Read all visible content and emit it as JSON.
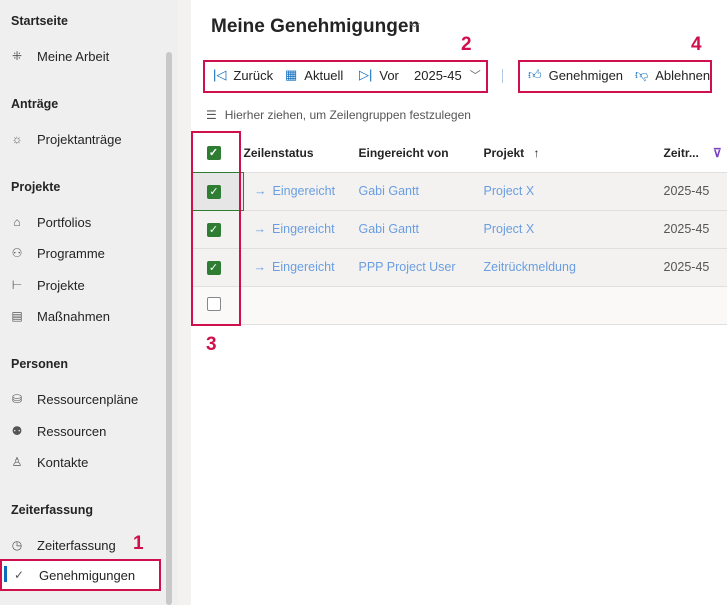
{
  "sidebar": {
    "sections": [
      {
        "title": "Startseite",
        "items": [
          {
            "label": "Meine Arbeit",
            "icon": "my-work-icon"
          }
        ]
      },
      {
        "title": "Anträge",
        "items": [
          {
            "label": "Projektanträge",
            "icon": "lightbulb-icon"
          }
        ]
      },
      {
        "title": "Projekte",
        "items": [
          {
            "label": "Portfolios",
            "icon": "portfolio-icon"
          },
          {
            "label": "Programme",
            "icon": "program-icon"
          },
          {
            "label": "Projekte",
            "icon": "project-icon"
          },
          {
            "label": "Maßnahmen",
            "icon": "task-icon"
          }
        ]
      },
      {
        "title": "Personen",
        "items": [
          {
            "label": "Ressourcenpläne",
            "icon": "resource-plan-icon"
          },
          {
            "label": "Ressourcen",
            "icon": "people-icon"
          },
          {
            "label": "Kontakte",
            "icon": "person-icon"
          }
        ]
      },
      {
        "title": "Zeiterfassung",
        "items": [
          {
            "label": "Zeiterfassung",
            "icon": "clock-icon"
          },
          {
            "label": "Genehmigungen",
            "icon": "approval-icon",
            "active": true
          }
        ]
      }
    ]
  },
  "annotations": [
    "1",
    "2",
    "3",
    "4"
  ],
  "header": {
    "title": "Meine Genehmigungen"
  },
  "toolbar": {
    "back": "Zurück",
    "current": "Aktuell",
    "next": "Vor",
    "period": "2025-45",
    "approve": "Genehmigen",
    "reject": "Ablehnen"
  },
  "grouping_hint": "Hierher ziehen, um Zeilengruppen festzulegen",
  "table": {
    "columns": [
      "Zeilenstatus",
      "Eingereicht von",
      "Projekt",
      "Zeitr..."
    ],
    "rows": [
      {
        "status": "Eingereicht",
        "by": "Gabi Gantt",
        "project": "Project X",
        "period": "2025-45",
        "checked": true
      },
      {
        "status": "Eingereicht",
        "by": "Gabi Gantt",
        "project": "Project X",
        "period": "2025-45",
        "checked": true
      },
      {
        "status": "Eingereicht",
        "by": "PPP Project User",
        "project": "Zeitrückmeldung",
        "period": "2025-45",
        "checked": true
      }
    ]
  },
  "colors": {
    "accent": "#0f6cbd",
    "annotation": "#d0104c",
    "checkbox": "#2f7d32",
    "link": "#6a9ee0"
  }
}
